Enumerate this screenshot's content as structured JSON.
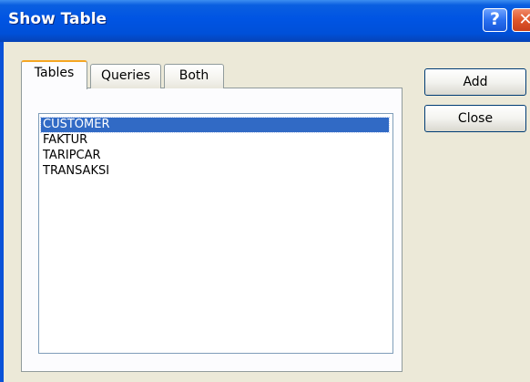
{
  "window": {
    "title": "Show Table",
    "help_label": "?",
    "close_label": "✕"
  },
  "tabs": [
    {
      "label": "Tables",
      "active": true
    },
    {
      "label": "Queries",
      "active": false
    },
    {
      "label": "Both",
      "active": false
    }
  ],
  "table_list": {
    "items": [
      "CUSTOMER",
      "FAKTUR",
      "TARIPCAR",
      "TRANSAKSI"
    ],
    "selected_index": 0
  },
  "buttons": {
    "add_label": "Add",
    "close_label": "Close"
  },
  "colors": {
    "titlebar": "#0054e3",
    "selection": "#316ac5",
    "dialog_bg": "#ece9d8",
    "active_tab_accent": "#f5a623"
  },
  "icons": {
    "help": "help-icon",
    "close": "close-icon"
  }
}
